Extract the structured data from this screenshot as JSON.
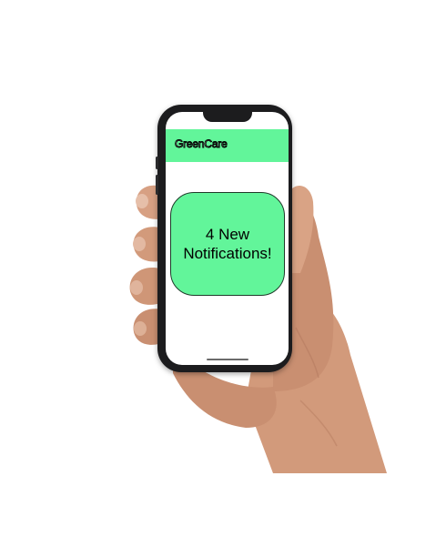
{
  "app": {
    "name": "GreenCare",
    "accent_color": "#62f59a"
  },
  "notification_card": {
    "line1": "4 New",
    "line2": "Notifications!"
  },
  "icons": [
    "notch",
    "home-indicator"
  ]
}
